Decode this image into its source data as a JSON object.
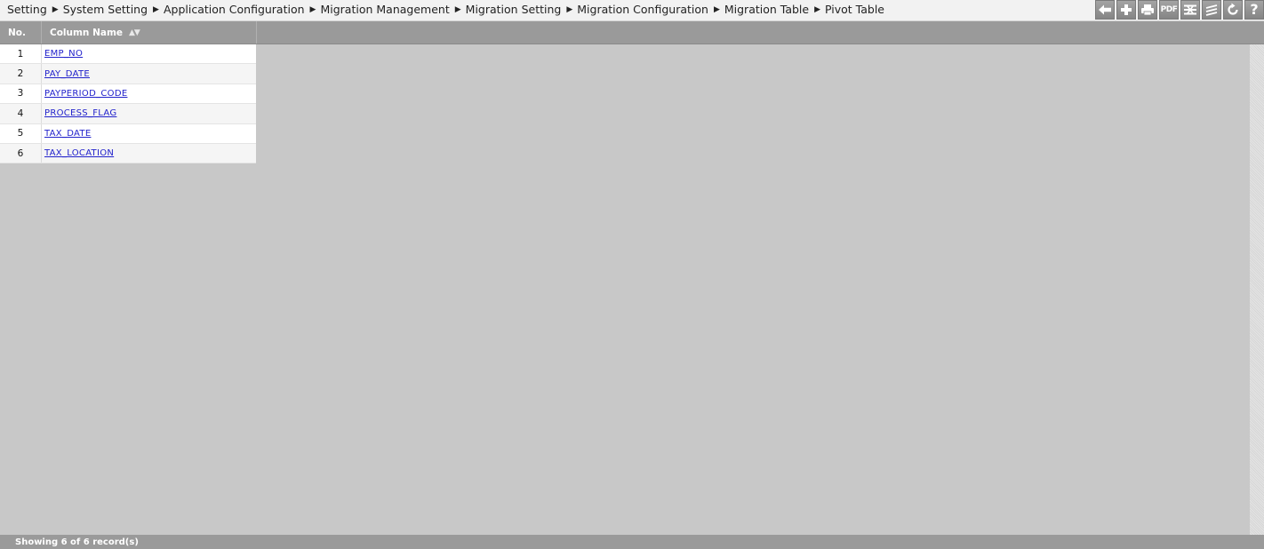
{
  "breadcrumb": [
    "Setting",
    "System Setting",
    "Application Configuration",
    "Migration Management",
    "Migration Setting",
    "Migration Configuration",
    "Migration Table",
    "Pivot Table"
  ],
  "breadcrumb_separator": "▶",
  "toolbar": {
    "buttons": [
      {
        "name": "back",
        "icon": "arrow-left-icon"
      },
      {
        "name": "add",
        "icon": "plus-icon"
      },
      {
        "name": "print",
        "icon": "printer-icon"
      },
      {
        "name": "pdf",
        "icon": "pdf-icon",
        "label": "PDF"
      },
      {
        "name": "column-settings",
        "icon": "columns-icon"
      },
      {
        "name": "filter",
        "icon": "filter-icon"
      },
      {
        "name": "refresh",
        "icon": "refresh-icon"
      },
      {
        "name": "help",
        "icon": "help-icon",
        "label": "?"
      }
    ]
  },
  "table": {
    "headers": {
      "no": "No.",
      "column_name": "Column Name",
      "sort_indicator": "▲▼"
    },
    "rows": [
      {
        "no": "1",
        "column_name": "EMP_NO"
      },
      {
        "no": "2",
        "column_name": "PAY_DATE"
      },
      {
        "no": "3",
        "column_name": "PAYPERIOD_CODE"
      },
      {
        "no": "4",
        "column_name": "PROCESS_FLAG"
      },
      {
        "no": "5",
        "column_name": "TAX_DATE"
      },
      {
        "no": "6",
        "column_name": "TAX_LOCATION"
      }
    ]
  },
  "footer": {
    "status": "Showing 6 of 6 record(s)"
  },
  "colors": {
    "header_bg": "#9a9a9a",
    "workspace_bg": "#c8c8c8",
    "link": "#2222cc"
  }
}
